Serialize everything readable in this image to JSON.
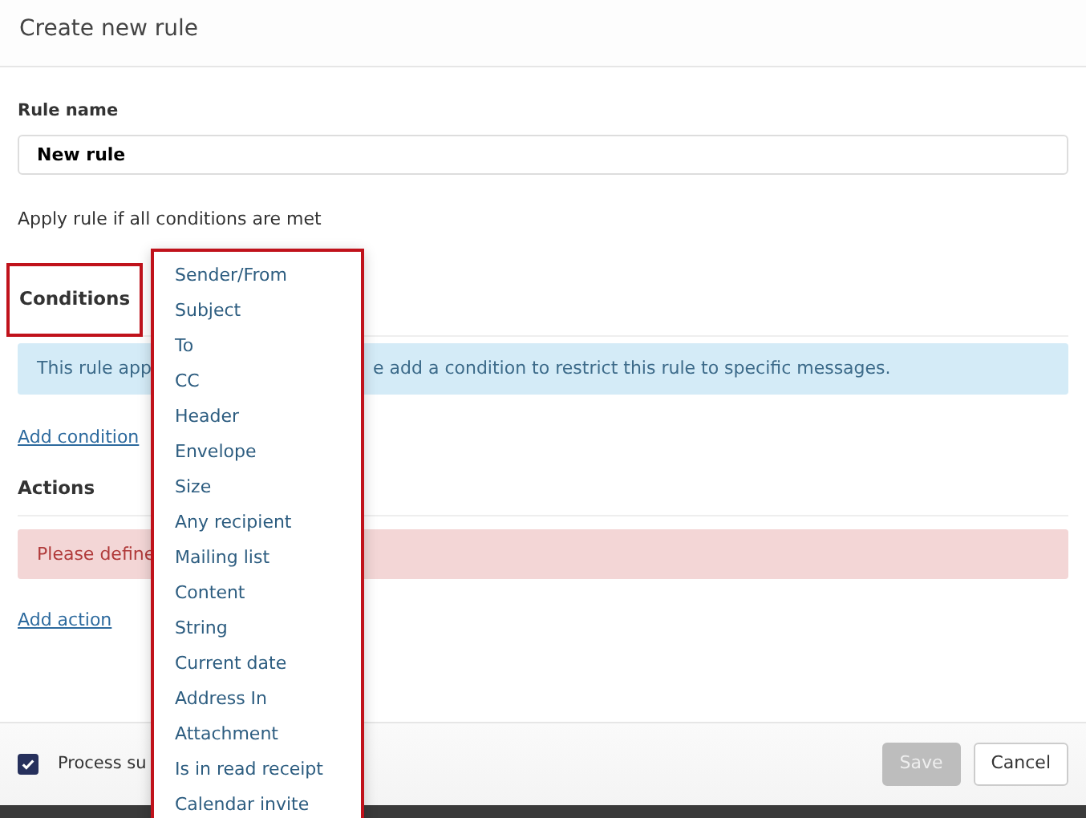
{
  "modal": {
    "title": "Create new rule"
  },
  "rule_name": {
    "label": "Rule name",
    "value": "New rule"
  },
  "apply_text": "Apply rule if all conditions are met",
  "conditions": {
    "heading": "Conditions",
    "highlighted": true,
    "info_parts": [
      "This rule app",
      "e add a condition to restrict this rule to specific messages."
    ],
    "add_link": "Add condition"
  },
  "actions": {
    "heading": "Actions",
    "error_parts": [
      "Please define"
    ],
    "add_link": "Add action"
  },
  "footer": {
    "checkbox": {
      "label": "Process su",
      "checked": true
    },
    "buttons": [
      {
        "label": "Save",
        "disabled": true
      },
      {
        "label": "Cancel",
        "disabled": false
      }
    ]
  },
  "dropdown": {
    "highlighted": true,
    "items": [
      {
        "label": "Sender/From"
      },
      {
        "label": "Subject"
      },
      {
        "label": "To"
      },
      {
        "label": "CC"
      },
      {
        "label": "Header"
      },
      {
        "label": "Envelope"
      },
      {
        "label": "Size"
      },
      {
        "label": "Any recipient"
      },
      {
        "label": "Mailing list"
      },
      {
        "label": "Content"
      },
      {
        "label": "String"
      },
      {
        "label": "Current date"
      },
      {
        "label": "Address In"
      },
      {
        "label": "Attachment"
      },
      {
        "label": "Is in read receipt"
      },
      {
        "label": "Calendar invite"
      }
    ]
  }
}
